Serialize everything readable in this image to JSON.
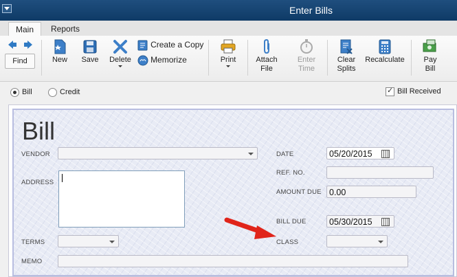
{
  "window": {
    "title": "Enter Bills"
  },
  "tabs": [
    {
      "label": "Main"
    },
    {
      "label": "Reports"
    }
  ],
  "toolbar": {
    "find": "Find",
    "new": "New",
    "save": "Save",
    "delete": "Delete",
    "create_copy": "Create a Copy",
    "memorize": "Memorize",
    "print": "Print",
    "attach_l1": "Attach",
    "attach_l2": "File",
    "enter_l1": "Enter",
    "enter_l2": "Time",
    "clear_l1": "Clear",
    "clear_l2": "Splits",
    "recalculate": "Recalculate",
    "pay_l1": "Pay",
    "pay_l2": "Bill"
  },
  "type_options": {
    "bill": "Bill",
    "credit": "Credit",
    "selected": "Bill"
  },
  "bill_received": {
    "label": "Bill Received",
    "checked": true
  },
  "form": {
    "title": "Bill",
    "vendor_label": "VENDOR",
    "vendor_value": "",
    "address_label": "ADDRESS",
    "address_value": "",
    "terms_label": "TERMS",
    "terms_value": "",
    "memo_label": "MEMO",
    "memo_value": "",
    "date_label": "DATE",
    "date_value": "05/20/2015",
    "ref_label": "REF. NO.",
    "ref_value": "",
    "amount_due_label": "AMOUNT DUE",
    "amount_due_value": "0.00",
    "bill_due_label": "BILL DUE",
    "bill_due_value": "05/30/2015",
    "class_label": "CLASS",
    "class_value": ""
  },
  "colors": {
    "title_bar": "#1a4a7a",
    "form_bg": "#e8ebf5",
    "arrow": "#e0241a"
  }
}
